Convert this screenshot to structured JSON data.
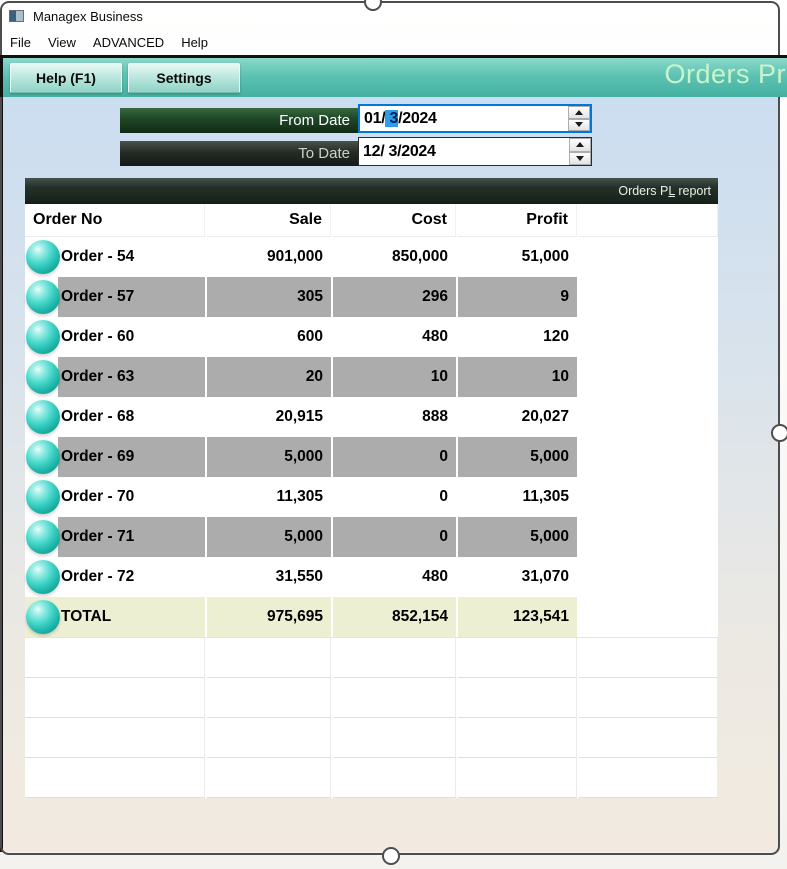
{
  "window": {
    "title": "Managex Business"
  },
  "menu": {
    "items": [
      "File",
      "View",
      "ADVANCED",
      "Help"
    ]
  },
  "toolbar": {
    "help_button": "Help (F1)",
    "settings_button": "Settings",
    "heading": "Orders Pr"
  },
  "filters": {
    "from_date": {
      "label": "From Date",
      "prefix": "01/",
      "selected": " 3",
      "suffix": "/2024"
    },
    "to_date": {
      "label": "To Date",
      "value": "12/ 3/2024"
    }
  },
  "report_bar": {
    "prefix": "Orders P",
    "mnemonic": "L",
    "suffix": " report"
  },
  "table": {
    "headers": {
      "order": "Order No",
      "sale": "Sale",
      "cost": "Cost",
      "profit": "Profit"
    },
    "rows": [
      {
        "order": "Order - 54",
        "sale": "901,000",
        "cost": "850,000",
        "profit": "51,000"
      },
      {
        "order": "Order - 57",
        "sale": "305",
        "cost": "296",
        "profit": "9"
      },
      {
        "order": "Order - 60",
        "sale": "600",
        "cost": "480",
        "profit": "120"
      },
      {
        "order": "Order - 63",
        "sale": "20",
        "cost": "10",
        "profit": "10"
      },
      {
        "order": "Order - 68",
        "sale": "20,915",
        "cost": "888",
        "profit": "20,027"
      },
      {
        "order": "Order - 69",
        "sale": "5,000",
        "cost": "0",
        "profit": "5,000"
      },
      {
        "order": "Order - 70",
        "sale": "11,305",
        "cost": "0",
        "profit": "11,305"
      },
      {
        "order": "Order - 71",
        "sale": "5,000",
        "cost": "0",
        "profit": "5,000"
      },
      {
        "order": "Order - 72",
        "sale": "31,550",
        "cost": "480",
        "profit": "31,070"
      },
      {
        "order": "TOTAL",
        "sale": "975,695",
        "cost": "852,154",
        "profit": "123,541",
        "is_total": true
      }
    ],
    "empty_rows": 4
  },
  "colors": {
    "toolbar_teal": "#55C1B1",
    "heading_green": "#C9F4CB",
    "stripe_gray": "#ACACAC",
    "total_row_bg": "#EDEFD3",
    "from_bar_green": "#1E4626",
    "to_bar_dark": "#252C26",
    "selection_blue": "#2E9CEC",
    "focus_border_blue": "#0078D7",
    "sphere_teal": "#2CC5B8"
  }
}
